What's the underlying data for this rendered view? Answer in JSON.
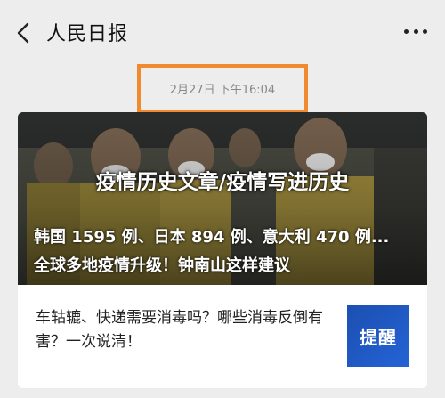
{
  "header": {
    "title": "人民日报",
    "back_icon": "chevron-left-icon",
    "more_icon": "more-dots-icon"
  },
  "message": {
    "timestamp": "2月27日 下午16:04",
    "highlight_color": "#f08a2c"
  },
  "card": {
    "headline": "疫情历史文章/疫情写进历史",
    "subline1": "韩国 1595 例、日本 894 例、意大利 470 例...",
    "subline2": "全球多地疫情升级！钟南山这样建议",
    "sub_article": {
      "title": "车轱辘、快递需要消毒吗？哪些消毒反倒有害？一次说清！",
      "thumb_text": "提醒",
      "thumb_color": "#2160cf"
    }
  }
}
